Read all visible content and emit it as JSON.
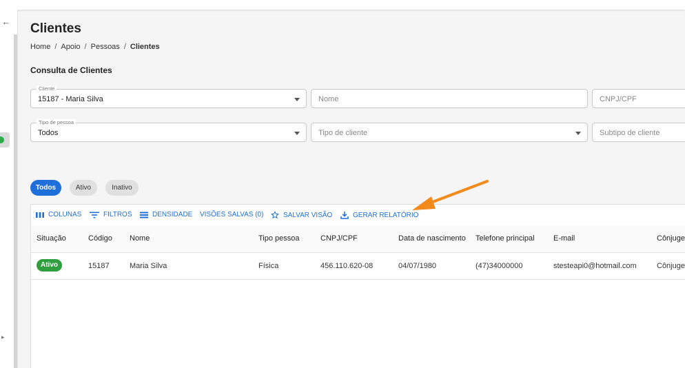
{
  "page": {
    "title": "Clientes",
    "breadcrumb": [
      "Home",
      "Apoio",
      "Pessoas",
      "Clientes"
    ],
    "section_title": "Consulta de Clientes"
  },
  "filters": {
    "cliente": {
      "label": "Cliente",
      "value": "15187 - Maria Silva"
    },
    "nome": {
      "placeholder": "Nome"
    },
    "cnpj_cpf": {
      "placeholder": "CNPJ/CPF"
    },
    "tipo_pessoa": {
      "label": "Tipo de pessoa",
      "value": "Todos"
    },
    "tipo_cliente": {
      "placeholder": "Tipo de cliente"
    },
    "subtipo_cliente": {
      "placeholder": "Subtipo de cliente"
    }
  },
  "status_tabs": [
    {
      "label": "Todos",
      "active": true
    },
    {
      "label": "Ativo",
      "active": false
    },
    {
      "label": "Inativo",
      "active": false
    }
  ],
  "toolbar": {
    "colunas": "COLUNAS",
    "filtros": "FILTROS",
    "densidade": "DENSIDADE",
    "visoes_salvas": "VISÕES SALVAS (0)",
    "salvar_visao": "SALVAR VISÃO",
    "gerar_relatorio": "GERAR RELATÓRIO"
  },
  "table": {
    "columns": [
      "Situação",
      "Código",
      "Nome",
      "Tipo pessoa",
      "CNPJ/CPF",
      "Data de nascimento",
      "Telefone principal",
      "E-mail",
      "Cônjuge"
    ],
    "rows": [
      {
        "situacao": "Ativo",
        "codigo": "15187",
        "nome": "Maria Silva",
        "tipo_pessoa": "Física",
        "cnpj_cpf": "456.110.620-08",
        "data_nascimento": "04/07/1980",
        "telefone": "(47)34000000",
        "email": "stesteapi0@hotmail.com",
        "conjuge": "Cônjuge"
      }
    ]
  },
  "colors": {
    "accent": "#1e6fd9",
    "active_status": "#2e9e3e",
    "annotation_arrow": "#f28a1c"
  }
}
